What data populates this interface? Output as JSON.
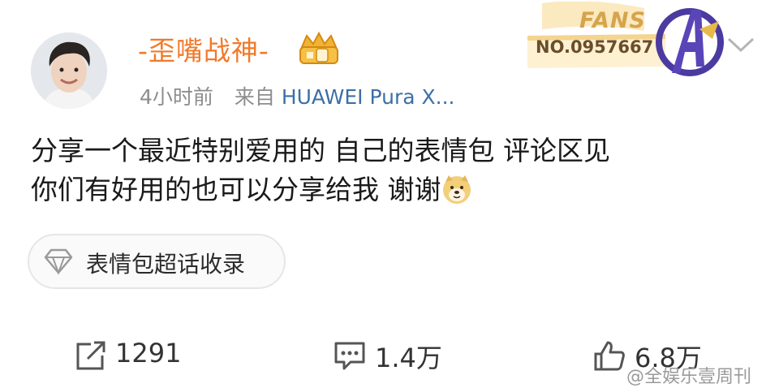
{
  "post": {
    "username": "-歪嘴战神-",
    "time": "4小时前",
    "source_prefix": "来自",
    "device": "HUAWEI Pura X...",
    "text_line1": "分享一个最近特别爱用的 自己的表情包 评论区见",
    "text_line2": "你们有好用的也可以分享给我 谢谢",
    "inline_emoji": "doge-emoji"
  },
  "fans_badge": {
    "label": "FANS",
    "number": "NO.0957667",
    "icon": "avengers-icon"
  },
  "topic": {
    "label": "表情包超话收录",
    "icon": "diamond-icon"
  },
  "actions": {
    "repost_count": "1291",
    "comment_count": "1.4万",
    "like_count": "6.8万"
  },
  "watermark": "@全娱乐壹周刊",
  "colors": {
    "username": "#f07a2a",
    "device_link": "#3c6fa6",
    "meta": "#8d8d8d",
    "badge_gold": "#d6a44c"
  }
}
